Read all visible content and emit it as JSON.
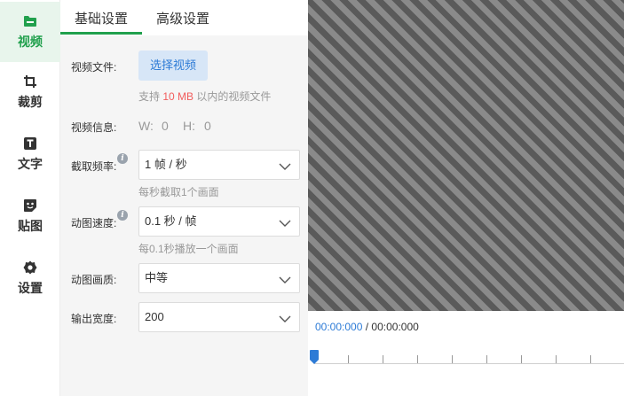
{
  "sidebar": {
    "items": [
      {
        "label": "视频",
        "icon": "folder-video-icon",
        "active": true
      },
      {
        "label": "裁剪",
        "icon": "crop-icon",
        "active": false
      },
      {
        "label": "文字",
        "icon": "text-icon",
        "active": false
      },
      {
        "label": "贴图",
        "icon": "sticker-icon",
        "active": false
      },
      {
        "label": "设置",
        "icon": "gear-icon",
        "active": false
      }
    ]
  },
  "tabs": [
    {
      "label": "基础设置",
      "active": true
    },
    {
      "label": "高级设置",
      "active": false
    }
  ],
  "video_file": {
    "label": "视频文件:",
    "button": "选择视频",
    "hint_prefix": "支持",
    "hint_limit": "10 MB",
    "hint_suffix": "以内的视频文件"
  },
  "video_info": {
    "label": "视频信息:",
    "width_label": "W:",
    "width_value": "0",
    "height_label": "H:",
    "height_value": "0"
  },
  "capture_rate": {
    "label": "截取频率:",
    "value": "1 帧 / 秒",
    "hint": "每秒截取1个画面"
  },
  "gif_speed": {
    "label": "动图速度:",
    "value": "0.1 秒 / 帧",
    "hint": "每0.1秒播放一个画面"
  },
  "gif_quality": {
    "label": "动图画质:",
    "value": "中等"
  },
  "output_width": {
    "label": "输出宽度:",
    "value": "200"
  },
  "timeline": {
    "current": "00:00:000",
    "separator": "/",
    "total": "00:00:000"
  },
  "colors": {
    "accent": "#21a04d",
    "link": "#2d7bd6",
    "warn": "#f25d5d"
  }
}
